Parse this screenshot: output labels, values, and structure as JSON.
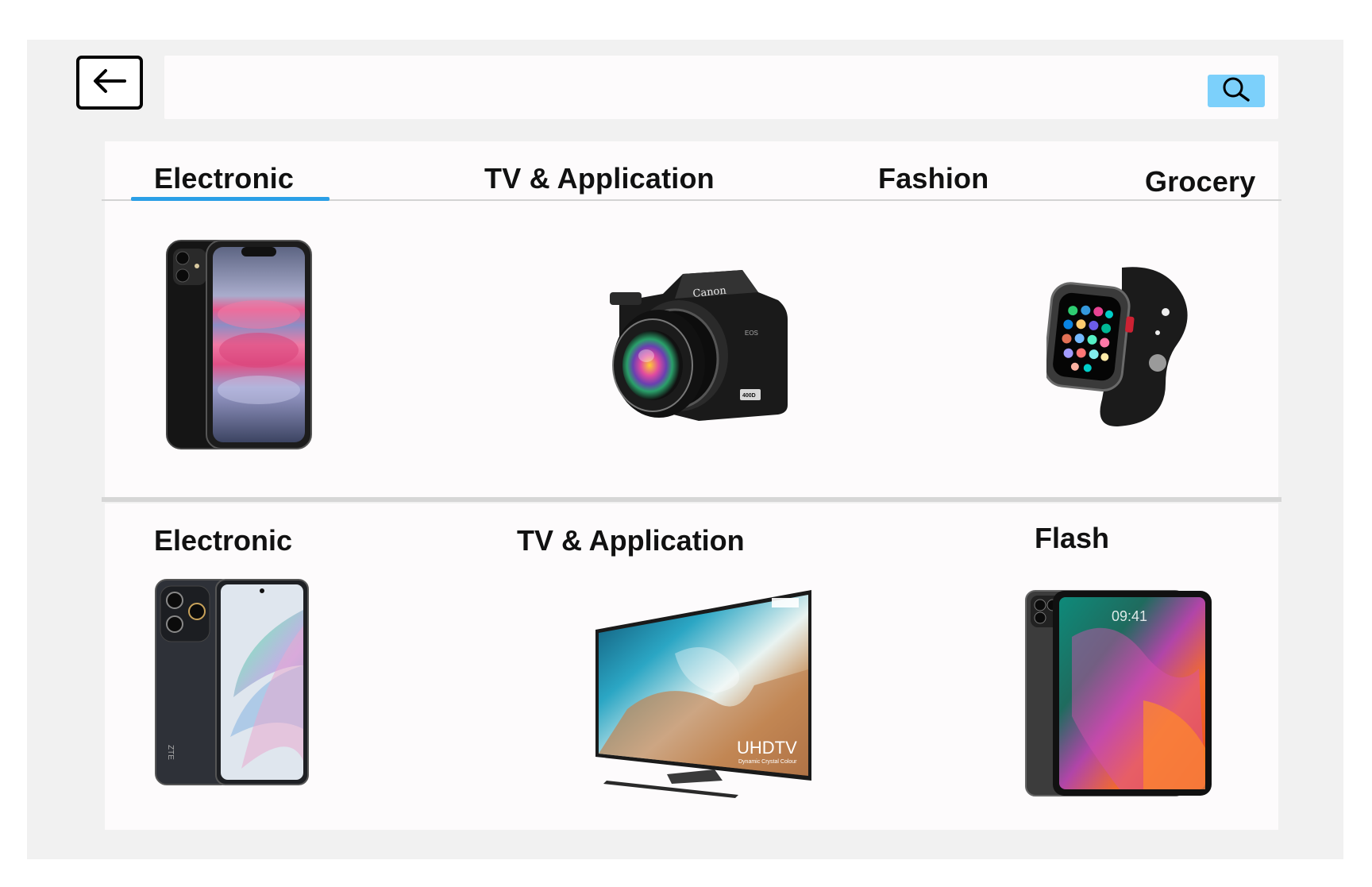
{
  "search": {
    "value": "",
    "placeholder": ""
  },
  "tabs": [
    {
      "label": "Electronic",
      "active": true
    },
    {
      "label": "TV & Application",
      "active": false
    },
    {
      "label": "Fashion",
      "active": false
    },
    {
      "label": "Grocery",
      "active": false
    }
  ],
  "featured_products": [
    {
      "icon": "smartphone-image"
    },
    {
      "icon": "dslr-camera-image",
      "brand": "Canon",
      "model": "EOS",
      "badge": "400D"
    },
    {
      "icon": "smartwatch-image"
    }
  ],
  "sections": [
    {
      "title": "Electronic",
      "product": {
        "icon": "smartphone-image",
        "brand": "ZTE"
      }
    },
    {
      "title": "TV & Application",
      "product": {
        "icon": "television-image",
        "brand_text": "UHDTV",
        "sub_text": "Dynamic Crystal Colour"
      }
    },
    {
      "title": "Flash",
      "product": {
        "icon": "tablet-image",
        "screen_time": "09:41"
      }
    }
  ],
  "colors": {
    "background": "#f1f1f1",
    "panel": "#fdfbfc",
    "accent": "#2b9fe6",
    "search_button": "#7cd0fb"
  }
}
